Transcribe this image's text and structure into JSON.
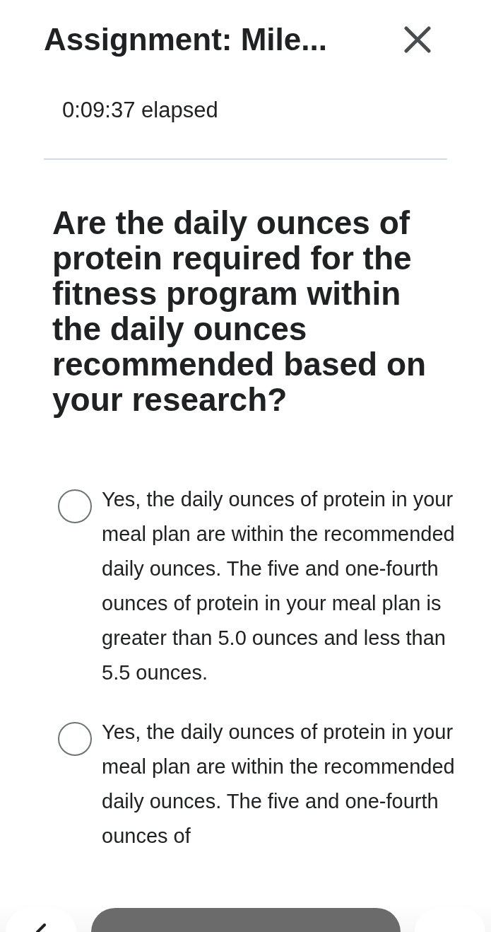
{
  "header": {
    "title": "Assignment: Mile...",
    "elapsed": "0:09:37 elapsed"
  },
  "question": {
    "text": "Are the daily ounces of protein required for the fitness program within the daily ounces recommended based on your research?"
  },
  "options": [
    {
      "text": "Yes, the daily ounces of protein in your meal plan are within the recommended daily ounces. The five and one-fourth ounces of protein in your meal plan is greater than 5.0 ounces and less than 5.5 ounces.",
      "selected": false
    },
    {
      "text": "Yes, the daily ounces of protein in your meal plan are within the recommended daily ounces. The five and one-fourth ounces of",
      "selected": false
    }
  ]
}
